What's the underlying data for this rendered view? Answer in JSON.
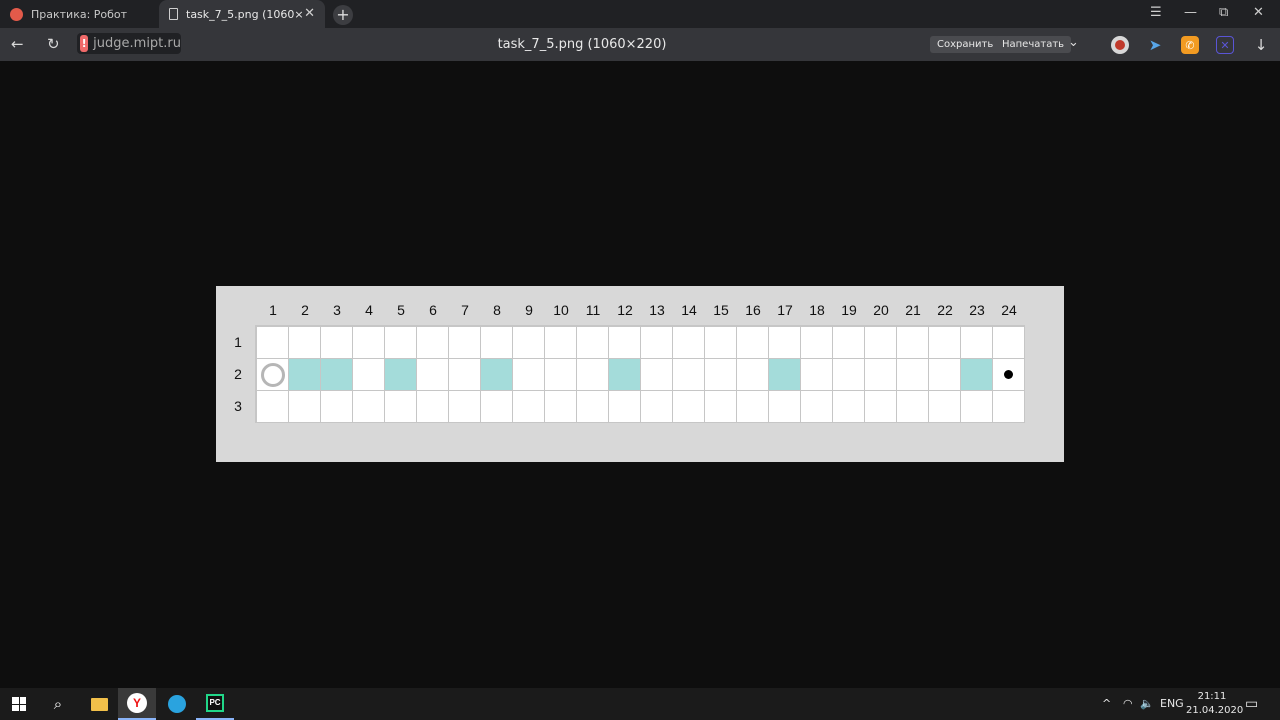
{
  "browser": {
    "tabs": [
      {
        "title": "Практика: Робот",
        "active": false
      },
      {
        "title": "task_7_5.png (1060×220)",
        "active": true
      }
    ],
    "new_tab_label": "+",
    "window_controls": {
      "menu": "☰",
      "minimize": "—",
      "restore": "⧉",
      "close": "✕"
    },
    "tab_close_label": "✕",
    "nav": {
      "back": "←",
      "reload": "↻"
    },
    "address": {
      "warning_symbol": "!",
      "domain": "judge.mipt.ru"
    },
    "page_title": "task_7_5.png (1060×220)",
    "actions": {
      "save_label": "Сохранить",
      "print_label": "Напечатать",
      "more": "⌄"
    },
    "extension_glyphs": {
      "send": "➤",
      "chat": "✆",
      "box": "✕",
      "download": "↓"
    }
  },
  "task_image": {
    "column_numbers": [
      "1",
      "2",
      "3",
      "4",
      "5",
      "6",
      "7",
      "8",
      "9",
      "10",
      "11",
      "12",
      "13",
      "14",
      "15",
      "16",
      "17",
      "18",
      "19",
      "20",
      "21",
      "22",
      "23",
      "24"
    ],
    "row_numbers": [
      "1",
      "2",
      "3"
    ],
    "rows": 3,
    "cols": 24,
    "painted_cells": [
      [
        2,
        2
      ],
      [
        2,
        3
      ],
      [
        2,
        5
      ],
      [
        2,
        8
      ],
      [
        2,
        12
      ],
      [
        2,
        17
      ],
      [
        2,
        23
      ]
    ],
    "robot_start": [
      2,
      1
    ],
    "target": [
      2,
      24
    ],
    "colors": {
      "painted": "#a4dcda",
      "cell": "#ffffff",
      "border": "#c6c6c6",
      "background": "#d8d8d8"
    }
  },
  "taskbar": {
    "search_glyph": "⌕",
    "yandex_letter": "Y",
    "pycharm_letters": "PC",
    "tray": {
      "chevron": "^",
      "wifi": "◠",
      "volume": "🔈",
      "language": "ENG"
    },
    "time": "21:11",
    "date": "21.04.2020",
    "notification_glyph": "▭"
  }
}
